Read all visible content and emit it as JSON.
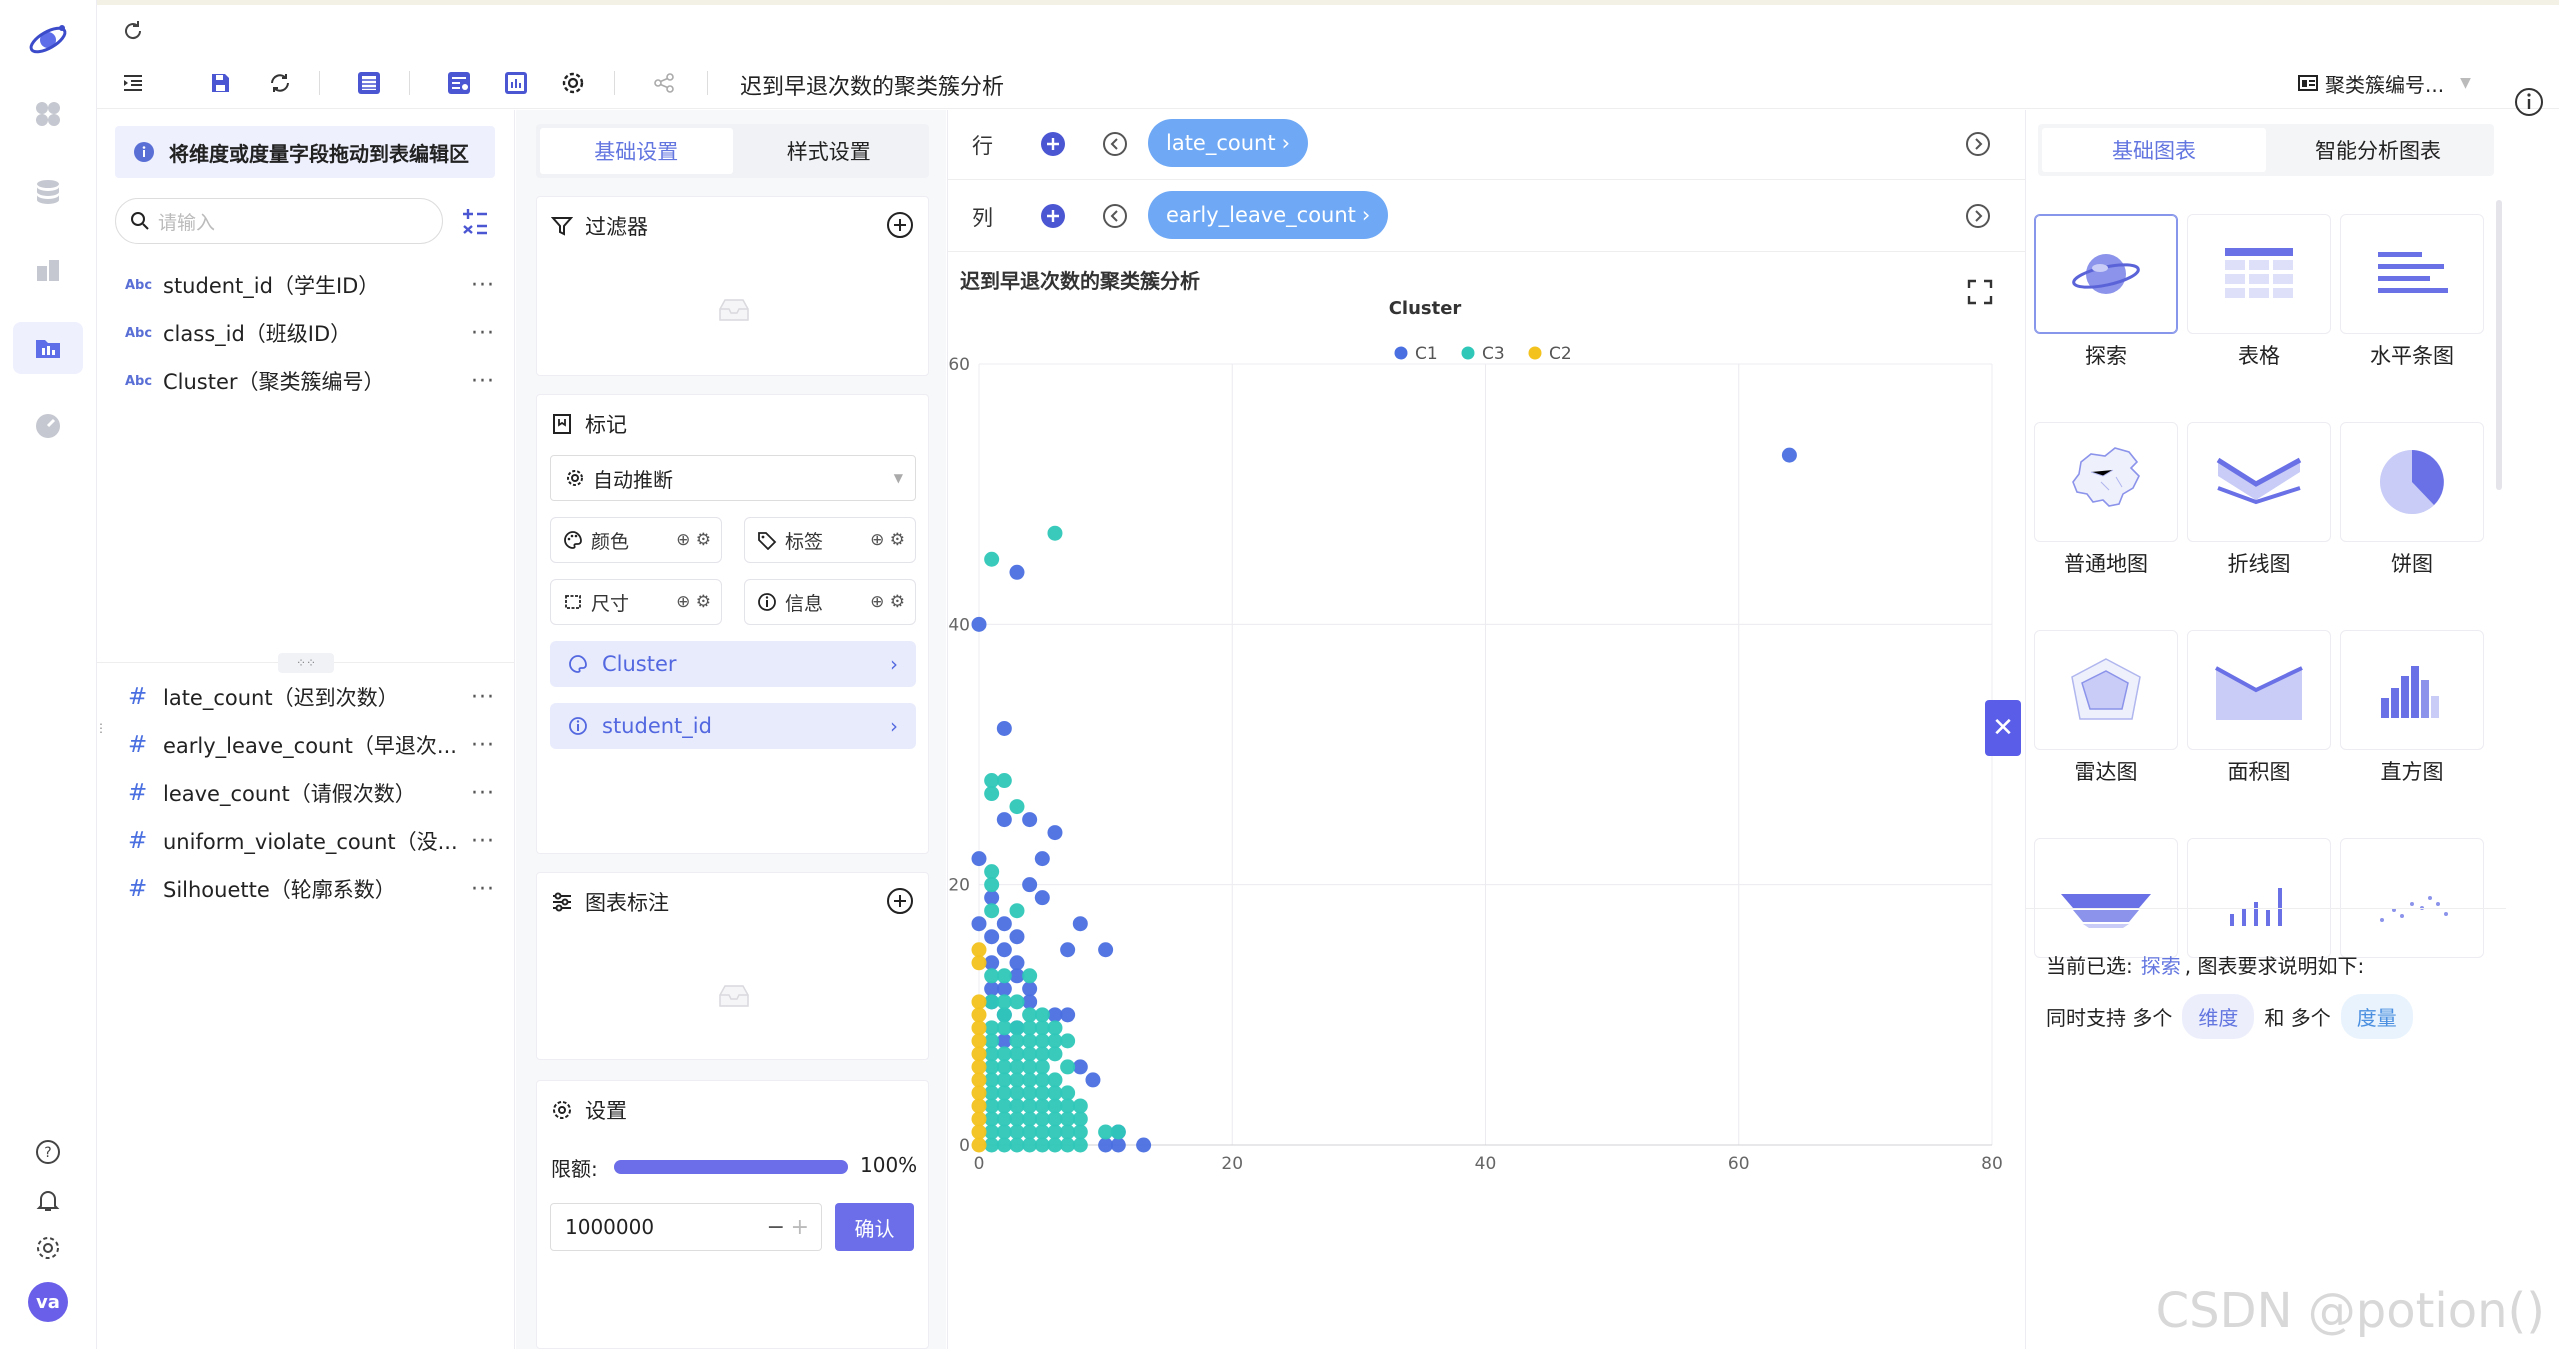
{
  "toolbar": {
    "chart_title": "迟到早退次数的聚类簇分析",
    "dataset_label": "聚类簇编号..."
  },
  "fields": {
    "hint": "将维度或度量字段拖动到表编辑区",
    "search_placeholder": "请输入",
    "dimensions": [
      {
        "type": "Abc",
        "label": "student_id（学生ID）"
      },
      {
        "type": "Abc",
        "label": "class_id（班级ID）"
      },
      {
        "type": "Abc",
        "label": "Cluster（聚类簇编号）"
      }
    ],
    "measures": [
      {
        "type": "#",
        "label": "late_count（迟到次数）"
      },
      {
        "type": "#",
        "label": "early_leave_count（早退次..."
      },
      {
        "type": "#",
        "label": "leave_count（请假次数）"
      },
      {
        "type": "#",
        "label": "uniform_violate_count（没..."
      },
      {
        "type": "#",
        "label": "Silhouette（轮廓系数）"
      }
    ],
    "more": "···"
  },
  "settings": {
    "tabs": [
      "基础设置",
      "样式设置"
    ],
    "filter_title": "过滤器",
    "marks_title": "标记",
    "mark_type": "自动推断",
    "chips": [
      "颜色",
      "标签",
      "尺寸",
      "信息"
    ],
    "mark_fields": [
      "Cluster",
      "student_id"
    ],
    "annotation_title": "图表标注",
    "setting_title": "设置",
    "limit_label": "限额:",
    "limit_percent": "100%",
    "limit_fraction": 1.0,
    "limit_value": "1000000",
    "confirm": "确认"
  },
  "shelves": {
    "row_label": "行",
    "row_field": "late_count",
    "col_label": "列",
    "col_field": "early_leave_count"
  },
  "chart": {
    "title": "迟到早退次数的聚类簇分析"
  },
  "chart_data": {
    "type": "scatter",
    "title": "迟到早退次数的聚类簇分析",
    "xlabel": "",
    "ylabel": "",
    "legend_title": "Cluster",
    "legend_position": "top",
    "xlim": [
      0,
      80
    ],
    "ylim": [
      0,
      60
    ],
    "xticks": [
      0,
      20,
      40,
      60,
      80
    ],
    "yticks": [
      0,
      20,
      40,
      60
    ],
    "grid": true,
    "series": [
      {
        "name": "C1",
        "color": "#4a6fe0",
        "points": [
          [
            64,
            53
          ],
          [
            3,
            44
          ],
          [
            0,
            40
          ],
          [
            2,
            32
          ],
          [
            0,
            22
          ],
          [
            2,
            25
          ],
          [
            4,
            25
          ],
          [
            5,
            22
          ],
          [
            6,
            24
          ],
          [
            4,
            20
          ],
          [
            1,
            19
          ],
          [
            5,
            19
          ],
          [
            8,
            17
          ],
          [
            7,
            15
          ],
          [
            10,
            15
          ],
          [
            2,
            17
          ],
          [
            1,
            16
          ],
          [
            3,
            16
          ],
          [
            2,
            15
          ],
          [
            3,
            14
          ],
          [
            1,
            14
          ],
          [
            3,
            13
          ],
          [
            2,
            12
          ],
          [
            4,
            12
          ],
          [
            7,
            10
          ],
          [
            6,
            10
          ],
          [
            1,
            12
          ],
          [
            2,
            10
          ],
          [
            3,
            9
          ],
          [
            2,
            8
          ],
          [
            8,
            6
          ],
          [
            9,
            5
          ],
          [
            11,
            1
          ],
          [
            13,
            0
          ],
          [
            10,
            0
          ],
          [
            11,
            0
          ],
          [
            0,
            17
          ],
          [
            1,
            11
          ],
          [
            4,
            11
          ]
        ]
      },
      {
        "name": "C3",
        "color": "#2ec7b8",
        "points": [
          [
            6,
            47
          ],
          [
            1,
            45
          ],
          [
            1,
            28
          ],
          [
            2,
            28
          ],
          [
            3,
            26
          ],
          [
            1,
            27
          ],
          [
            1,
            21
          ],
          [
            1,
            20
          ],
          [
            1,
            18
          ],
          [
            3,
            18
          ],
          [
            1,
            13
          ],
          [
            2,
            13
          ],
          [
            4,
            13
          ],
          [
            1,
            11
          ],
          [
            2,
            11
          ],
          [
            3,
            11
          ],
          [
            2,
            10
          ],
          [
            4,
            10
          ],
          [
            5,
            10
          ],
          [
            1,
            9
          ],
          [
            2,
            9
          ],
          [
            3,
            9
          ],
          [
            4,
            9
          ],
          [
            5,
            9
          ],
          [
            6,
            9
          ],
          [
            1,
            8
          ],
          [
            3,
            8
          ],
          [
            4,
            8
          ],
          [
            5,
            8
          ],
          [
            6,
            8
          ],
          [
            7,
            8
          ],
          [
            1,
            7
          ],
          [
            2,
            7
          ],
          [
            3,
            7
          ],
          [
            4,
            7
          ],
          [
            5,
            7
          ],
          [
            6,
            7
          ],
          [
            1,
            6
          ],
          [
            2,
            6
          ],
          [
            3,
            6
          ],
          [
            4,
            6
          ],
          [
            5,
            6
          ],
          [
            7,
            6
          ],
          [
            1,
            5
          ],
          [
            2,
            5
          ],
          [
            3,
            5
          ],
          [
            4,
            5
          ],
          [
            5,
            5
          ],
          [
            6,
            5
          ],
          [
            1,
            4
          ],
          [
            2,
            4
          ],
          [
            3,
            4
          ],
          [
            4,
            4
          ],
          [
            5,
            4
          ],
          [
            6,
            4
          ],
          [
            7,
            4
          ],
          [
            1,
            3
          ],
          [
            2,
            3
          ],
          [
            3,
            3
          ],
          [
            4,
            3
          ],
          [
            5,
            3
          ],
          [
            6,
            3
          ],
          [
            7,
            3
          ],
          [
            8,
            3
          ],
          [
            1,
            2
          ],
          [
            2,
            2
          ],
          [
            3,
            2
          ],
          [
            4,
            2
          ],
          [
            5,
            2
          ],
          [
            6,
            2
          ],
          [
            7,
            2
          ],
          [
            8,
            2
          ],
          [
            1,
            1
          ],
          [
            2,
            1
          ],
          [
            3,
            1
          ],
          [
            4,
            1
          ],
          [
            5,
            1
          ],
          [
            6,
            1
          ],
          [
            7,
            1
          ],
          [
            8,
            1
          ],
          [
            1,
            0
          ],
          [
            2,
            0
          ],
          [
            3,
            0
          ],
          [
            4,
            0
          ],
          [
            5,
            0
          ],
          [
            6,
            0
          ],
          [
            7,
            0
          ],
          [
            8,
            0
          ],
          [
            10,
            1
          ],
          [
            11,
            1
          ]
        ]
      },
      {
        "name": "C2",
        "color": "#f3c21d",
        "points": [
          [
            0,
            15
          ],
          [
            0,
            14
          ],
          [
            0,
            11
          ],
          [
            0,
            10
          ],
          [
            0,
            9
          ],
          [
            0,
            8
          ],
          [
            0,
            7
          ],
          [
            0,
            6
          ],
          [
            0,
            5
          ],
          [
            0,
            4
          ],
          [
            0,
            3
          ],
          [
            0,
            2
          ],
          [
            0,
            1
          ],
          [
            0,
            0
          ]
        ]
      }
    ]
  },
  "rightpanel": {
    "tabs": [
      "基础图表",
      "智能分析图表"
    ],
    "chart_types": [
      "探索",
      "表格",
      "水平条图",
      "普通地图",
      "折线图",
      "饼图",
      "雷达图",
      "面积图",
      "直方图"
    ],
    "selected_prefix": "当前已选:",
    "selected_name": "探索",
    "selected_suffix": ", 图表要求说明如下:",
    "req_prefix": "同时支持 多个",
    "req_dim": "维度",
    "req_mid": "和 多个",
    "req_measure": "度量"
  },
  "user": {
    "avatar": "va"
  },
  "watermark": "CSDN @potion()"
}
